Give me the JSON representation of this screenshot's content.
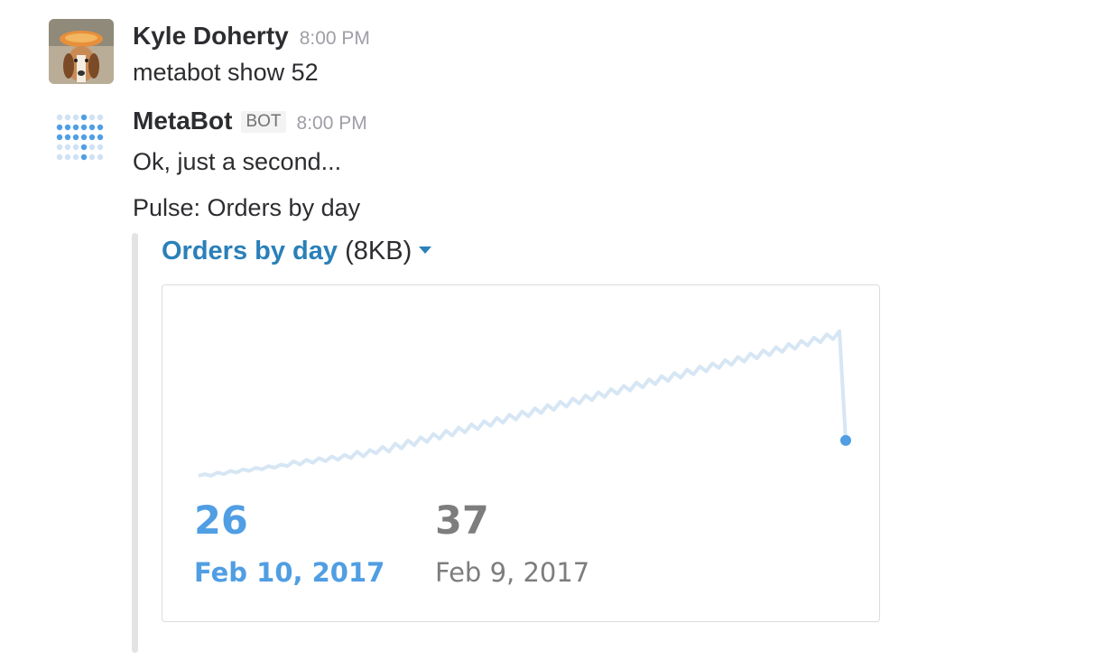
{
  "messages": [
    {
      "author": "Kyle Doherty",
      "time": "8:00 PM",
      "text": "metabot show 52"
    },
    {
      "author": "MetaBot",
      "badge": "BOT",
      "time": "8:00 PM",
      "text": "Ok, just a second...",
      "pulse_text": "Pulse: Orders by day"
    }
  ],
  "attachment": {
    "title": "Orders by day",
    "size": "(8KB)",
    "icon": "caret-down-icon"
  },
  "colors": {
    "accent": "#509ee3",
    "link": "#2a80b9",
    "line": "#d6e6f4",
    "muted": "#7d7d7d"
  },
  "chart_data": {
    "type": "line",
    "series": [
      {
        "values": [
          4,
          5,
          4,
          6,
          5,
          7,
          6,
          8,
          7,
          9,
          8,
          10,
          9,
          11,
          10,
          13,
          11,
          14,
          12,
          15,
          13,
          16,
          14,
          17,
          15,
          19,
          16,
          20,
          18,
          22,
          19,
          24,
          21,
          26,
          23,
          28,
          25,
          30,
          27,
          32,
          29,
          34,
          31,
          36,
          33,
          38,
          35,
          40,
          37,
          42,
          39,
          44,
          41,
          46,
          43,
          48,
          45,
          50,
          47,
          52,
          49,
          54,
          51,
          56,
          53,
          58,
          55,
          60,
          57,
          62,
          59,
          64,
          61,
          66,
          63,
          68,
          65,
          70,
          67,
          72,
          69,
          74,
          71,
          76,
          73,
          78,
          75,
          80,
          77,
          82,
          79,
          84,
          81,
          86,
          83,
          88,
          85,
          90,
          87,
          92,
          89,
          94,
          26
        ]
      }
    ],
    "current": {
      "value": "26",
      "date": "Feb 10, 2017"
    },
    "previous": {
      "value": "37",
      "date": "Feb 9, 2017"
    }
  }
}
